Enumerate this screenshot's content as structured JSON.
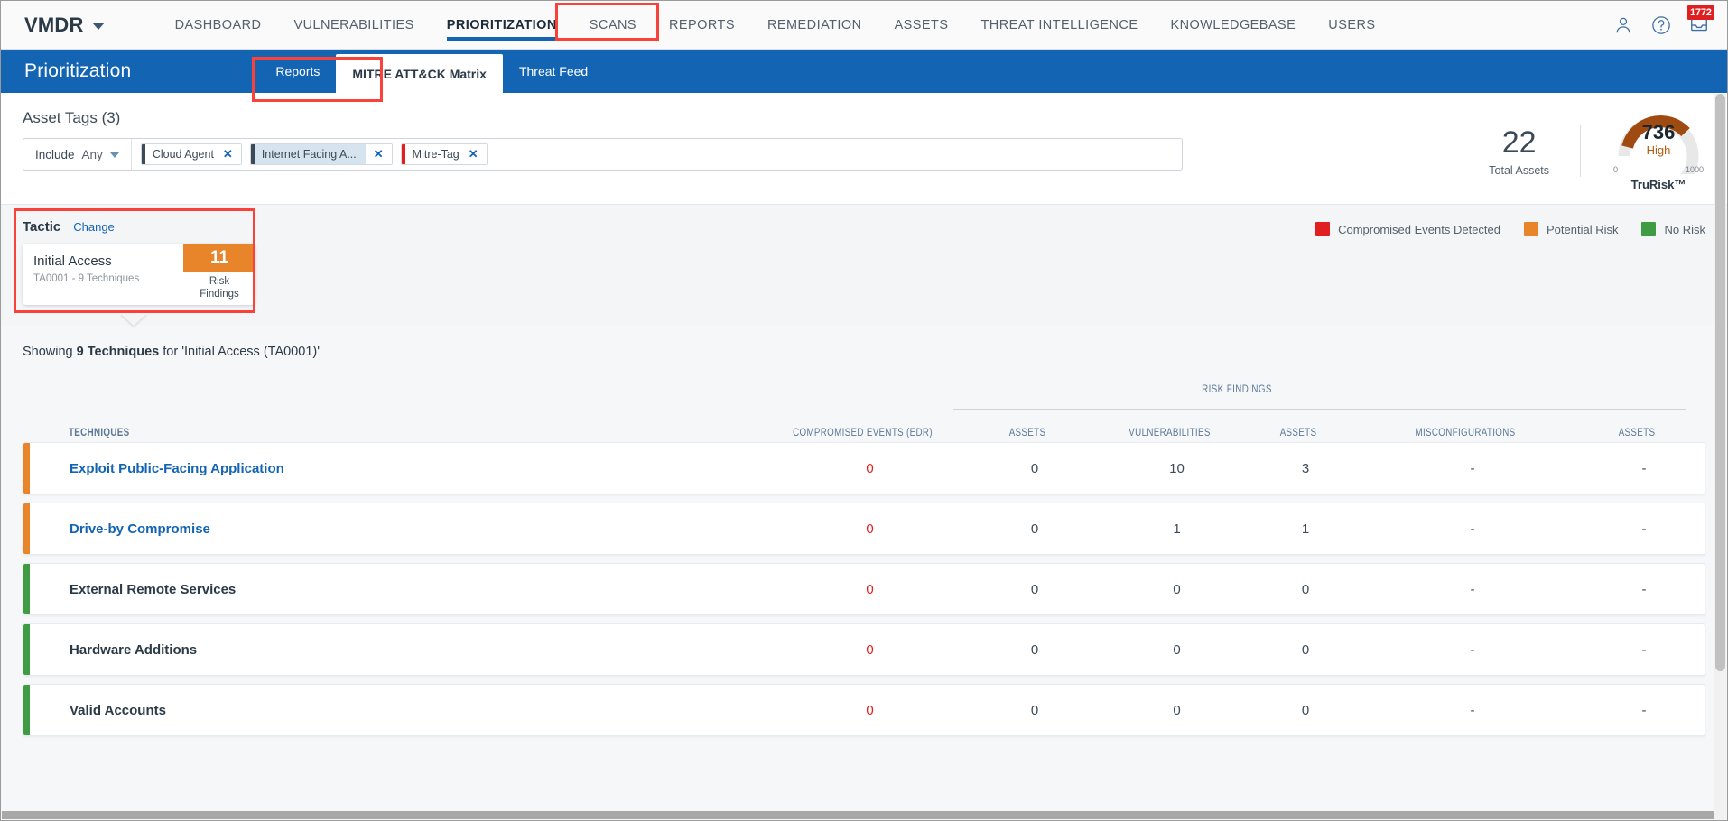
{
  "topnav": {
    "brand": "VMDR",
    "links": [
      {
        "label": "DASHBOARD",
        "active": false
      },
      {
        "label": "VULNERABILITIES",
        "active": false
      },
      {
        "label": "PRIORITIZATION",
        "active": true
      },
      {
        "label": "SCANS",
        "active": false
      },
      {
        "label": "REPORTS",
        "active": false
      },
      {
        "label": "REMEDIATION",
        "active": false
      },
      {
        "label": "ASSETS",
        "active": false
      },
      {
        "label": "THREAT INTELLIGENCE",
        "active": false
      },
      {
        "label": "KNOWLEDGEBASE",
        "active": false
      },
      {
        "label": "USERS",
        "active": false
      }
    ],
    "icons": [
      "user-icon",
      "help-icon",
      "inbox-icon"
    ],
    "notification_count": "1772"
  },
  "subheader": {
    "title": "Prioritization",
    "tabs": [
      {
        "label": "Reports",
        "active": false
      },
      {
        "label": "MITRE ATT&CK Matrix",
        "active": true
      },
      {
        "label": "Threat Feed",
        "active": false
      }
    ]
  },
  "asset_tags": {
    "title": "Asset Tags (3)",
    "include_label": "Include",
    "include_value": "Any",
    "chips": [
      {
        "label": "Cloud Agent",
        "bar_color": "#3c4a57",
        "highlight": false
      },
      {
        "label": "Internet Facing A...",
        "bar_color": "#3c4a57",
        "highlight": true
      },
      {
        "label": "Mitre-Tag",
        "bar_color": "#e02020",
        "highlight": false
      }
    ],
    "close_glyph": "✕"
  },
  "summary": {
    "total_assets_value": "22",
    "total_assets_label": "Total Assets",
    "trurisk_score": "736",
    "trurisk_severity": "High",
    "trurisk_min": "0",
    "trurisk_max": "1000",
    "trurisk_label": "TruRisk™",
    "gauge_color": "#9e4a10",
    "gauge_track": "#e8e8e8"
  },
  "tactic": {
    "heading": "Tactic",
    "change_label": "Change",
    "name": "Initial Access",
    "sub": "TA0001 - 9 Techniques",
    "count": "11",
    "count_caption_line1": "Risk",
    "count_caption_line2": "Findings",
    "count_color": "#e8842a"
  },
  "legend": [
    {
      "label": "Compromised Events Detected",
      "color": "#e02020"
    },
    {
      "label": "Potential Risk",
      "color": "#e8842a"
    },
    {
      "label": "No Risk",
      "color": "#3f9c42"
    }
  ],
  "table": {
    "showing_prefix": "Showing ",
    "showing_bold": "9 Techniques",
    "showing_suffix": " for 'Initial Access (TA0001)'",
    "group_header": "RISK FINDINGS",
    "headers": {
      "techniques": "TECHNIQUES",
      "compromised_events": "COMPROMISED EVENTS (EDR)",
      "assets_1": "ASSETS",
      "vulnerabilities": "VULNERABILITIES",
      "assets_2": "ASSETS",
      "misconfigurations": "MISCONFIGURATIONS",
      "assets_3": "ASSETS"
    },
    "rows": [
      {
        "name": "Exploit Public-Facing Application",
        "accent": "#e8842a",
        "is_link": true,
        "compromised_events": "0",
        "assets_1": "0",
        "vulnerabilities": "10",
        "assets_2": "3",
        "misconfigurations": "-",
        "assets_3": "-"
      },
      {
        "name": "Drive-by Compromise",
        "accent": "#e8842a",
        "is_link": true,
        "compromised_events": "0",
        "assets_1": "0",
        "vulnerabilities": "1",
        "assets_2": "1",
        "misconfigurations": "-",
        "assets_3": "-"
      },
      {
        "name": "External Remote Services",
        "accent": "#3f9c42",
        "is_link": false,
        "compromised_events": "0",
        "assets_1": "0",
        "vulnerabilities": "0",
        "assets_2": "0",
        "misconfigurations": "-",
        "assets_3": "-"
      },
      {
        "name": "Hardware Additions",
        "accent": "#3f9c42",
        "is_link": false,
        "compromised_events": "0",
        "assets_1": "0",
        "vulnerabilities": "0",
        "assets_2": "0",
        "misconfigurations": "-",
        "assets_3": "-"
      },
      {
        "name": "Valid Accounts",
        "accent": "#3f9c42",
        "is_link": false,
        "compromised_events": "0",
        "assets_1": "0",
        "vulnerabilities": "0",
        "assets_2": "0",
        "misconfigurations": "-",
        "assets_3": "-"
      }
    ]
  }
}
